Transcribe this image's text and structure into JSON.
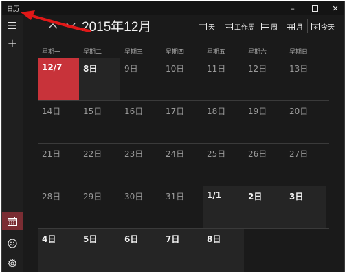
{
  "window": {
    "title": "日历",
    "minimize": "–",
    "close": "✕"
  },
  "rail": {
    "plus": "+"
  },
  "header": {
    "month_title": "2015年12月",
    "views": {
      "day": "天",
      "workweek": "工作周",
      "week": "周",
      "month": "月",
      "today": "今天"
    }
  },
  "weekdays": [
    "星期一",
    "星期二",
    "星期三",
    "星期四",
    "星期五",
    "星期六",
    "星期日"
  ],
  "weeks": [
    [
      "12/7",
      "8日",
      "9日",
      "10日",
      "11日",
      "12日",
      "13日"
    ],
    [
      "14日",
      "15日",
      "16日",
      "17日",
      "18日",
      "19日",
      "20日"
    ],
    [
      "21日",
      "22日",
      "23日",
      "24日",
      "25日",
      "26日",
      "27日"
    ],
    [
      "28日",
      "29日",
      "30日",
      "31日",
      "1/1",
      "2日",
      "3日"
    ],
    [
      "4日",
      "5日",
      "6日",
      "7日",
      "8日",
      "",
      ""
    ]
  ],
  "today_label": "12/7",
  "current_period_cells": [
    "1/1",
    "2日",
    "3日",
    "4日",
    "5日",
    "6日",
    "7日",
    "8日"
  ],
  "colors": {
    "today": "#c8333a",
    "annotation_arrow": "#e01818",
    "selected_rail": "#7a2d33"
  }
}
